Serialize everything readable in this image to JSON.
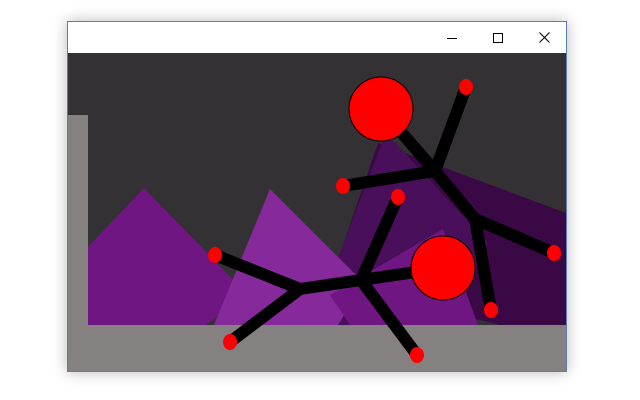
{
  "window": {
    "title": "",
    "controls": {
      "minimize_icon": "minimize-icon",
      "maximize_icon": "maximize-icon",
      "close_icon": "close-icon"
    }
  },
  "game": {
    "colors": {
      "sky": "#333133",
      "ground": "#858180",
      "wall": "#858180",
      "mountain_purple": "#6f1682",
      "mountain_light": "#86299a",
      "mountain_dark": "#4a0f5a",
      "mountain_darkest": "#3a0845",
      "limb": "#000000",
      "joint": "#ff0000",
      "head": "#ff0000"
    },
    "creatures": [
      {
        "name": "upper-creature",
        "head": "red-circle",
        "joints": 5
      },
      {
        "name": "lower-creature",
        "head": "red-circle",
        "joints": 4
      }
    ]
  }
}
